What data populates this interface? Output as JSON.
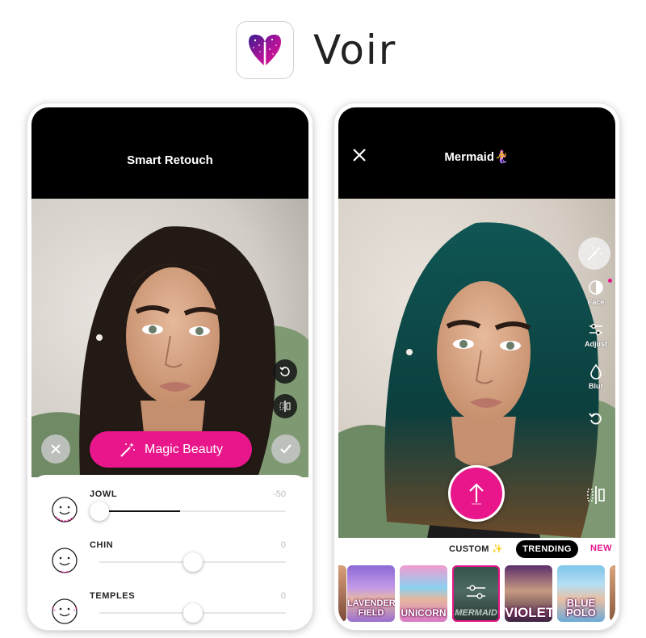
{
  "brand": {
    "name": "Voir"
  },
  "left_screen": {
    "title": "Smart Retouch",
    "magic_button": {
      "label": "Magic Beauty",
      "icon": "magic-wand-icon"
    },
    "adjustments": [
      {
        "name": "JOWL",
        "value": "-50",
        "level": 0.0
      },
      {
        "name": "CHIN",
        "value": "0",
        "level": 0.5
      },
      {
        "name": "TEMPLES",
        "value": "0",
        "level": 0.5
      }
    ]
  },
  "right_screen": {
    "title": "Mermaid🧜‍♀️",
    "tools": [
      {
        "label": "Face",
        "icon": "face-contrast-icon"
      },
      {
        "label": "Adjust",
        "icon": "sliders-icon"
      },
      {
        "label": "Blur",
        "icon": "drop-icon"
      }
    ],
    "tabs": {
      "custom": "CUSTOM ✨",
      "trending": "TRENDING",
      "new": "NEW"
    },
    "filters": [
      {
        "name": "LAVENDER FIELD"
      },
      {
        "name": "UNICORN"
      },
      {
        "name": "MERMAID"
      },
      {
        "name": "VIOLET"
      },
      {
        "name": "BLUE POLO"
      }
    ]
  },
  "colors": {
    "accent": "#e8168a",
    "topbar": "#000000"
  }
}
